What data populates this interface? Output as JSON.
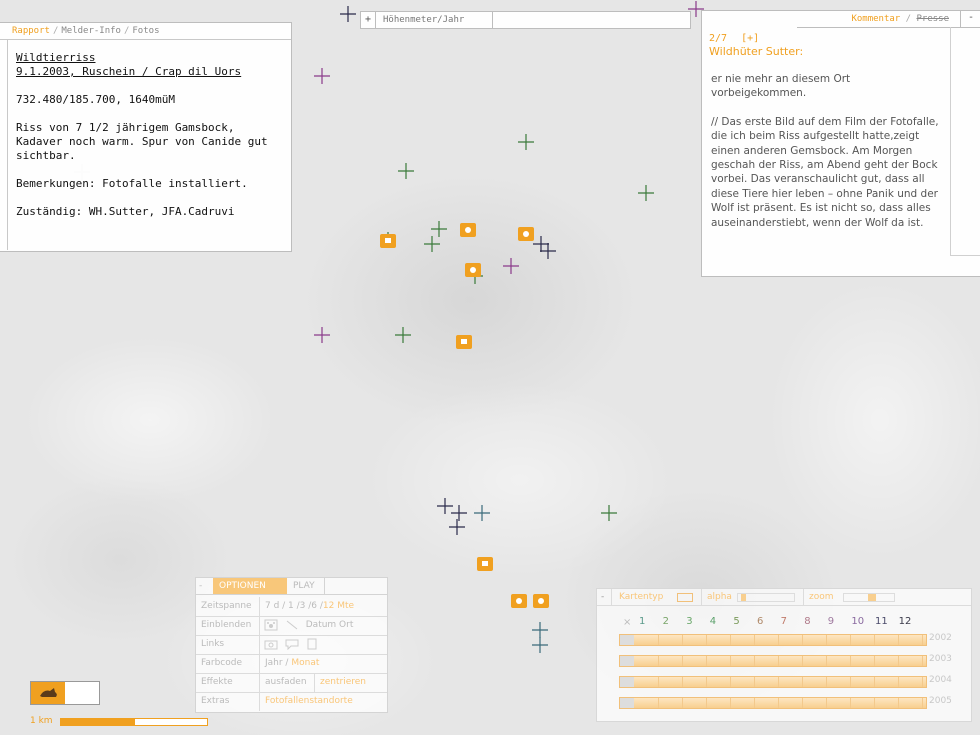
{
  "report": {
    "tabs": [
      "Rapport",
      "Melder-Info",
      "Fotos"
    ],
    "title": "Wildtierriss",
    "subtitle": "9.1.2003, Ruschein / Crap dil Uors",
    "coords": "732.480/185.700, 1640müM",
    "description": "Riss von 7 1/2 jährigem Gamsbock, Kadaver noch warm. Spur von Canide gut sichtbar.",
    "remarks": "Bemerkungen: Fotofalle installiert.",
    "responsible": "Zuständig: WH.Sutter, JFA.Cadruvi"
  },
  "altitude": {
    "plus": "+",
    "label": "Höhenmeter/Jahr"
  },
  "comment": {
    "tab_active": "Kommentar",
    "tab_inactive": "Presse",
    "minimize": "-",
    "counter": "2/7",
    "expand": "[+]",
    "author": "Wildhüter Sutter:",
    "paragraphs": [
      "er nie mehr an diesem Ort vorbeigekommen.",
      "// Das erste Bild auf dem Film der Fotofalle, die ich beim Riss aufgestellt hatte,zeigt einen anderen Gemsbock. Am Morgen geschah der Riss, am Abend geht der Bock vorbei. Das veranschaulicht gut, dass all diese Tiere hier leben – ohne Panik und der Wolf ist präsent. Es ist nicht so, dass alles auseinanderstiebt, wenn der Wolf da ist."
    ]
  },
  "options": {
    "minus": "-",
    "tab_options": "OPTIONEN",
    "tab_play": "PLAY",
    "rows": [
      {
        "key": "Zeitspanne",
        "value": "7 d / 1 /3 /6 /",
        "value_hl": "12 Mte"
      },
      {
        "key": "Einblenden",
        "value": "Datum  Ort",
        "value_hl": ""
      },
      {
        "key": "Links",
        "value": "",
        "value_hl": ""
      },
      {
        "key": "Farbcode",
        "value": "Jahr /",
        "value_hl": "Monat"
      },
      {
        "key": "Effekte",
        "value": "ausfaden",
        "value_hl": "zentrieren"
      },
      {
        "key": "Extras",
        "value": "",
        "value_hl": "Fotofallenstandorte"
      }
    ]
  },
  "legend": {
    "minus": "-",
    "map_type": "Kartentyp",
    "alpha": "alpha",
    "zoom": "zoom",
    "x": "×",
    "months": [
      "1",
      "2",
      "3",
      "4",
      "5",
      "6",
      "7",
      "8",
      "9",
      "10",
      "11",
      "12"
    ],
    "month_colors": [
      "#5a9a8a",
      "#7aa66a",
      "#6aa86a",
      "#5aa06a",
      "#7a9a5a",
      "#b08a6a",
      "#c07a6a",
      "#b07a8a",
      "#a07aa0",
      "#8a6aa0",
      "#4a4a6a",
      "#3a3a4a"
    ],
    "years": [
      "2002",
      "2003",
      "2004",
      "2005"
    ]
  },
  "scale": {
    "label": "1 km"
  },
  "colors": {
    "accent": "#f0a020",
    "green": "#3a7a3a",
    "purple": "#8a3a8a",
    "navy": "#2a2a4a",
    "teal": "#3a6a7a"
  }
}
